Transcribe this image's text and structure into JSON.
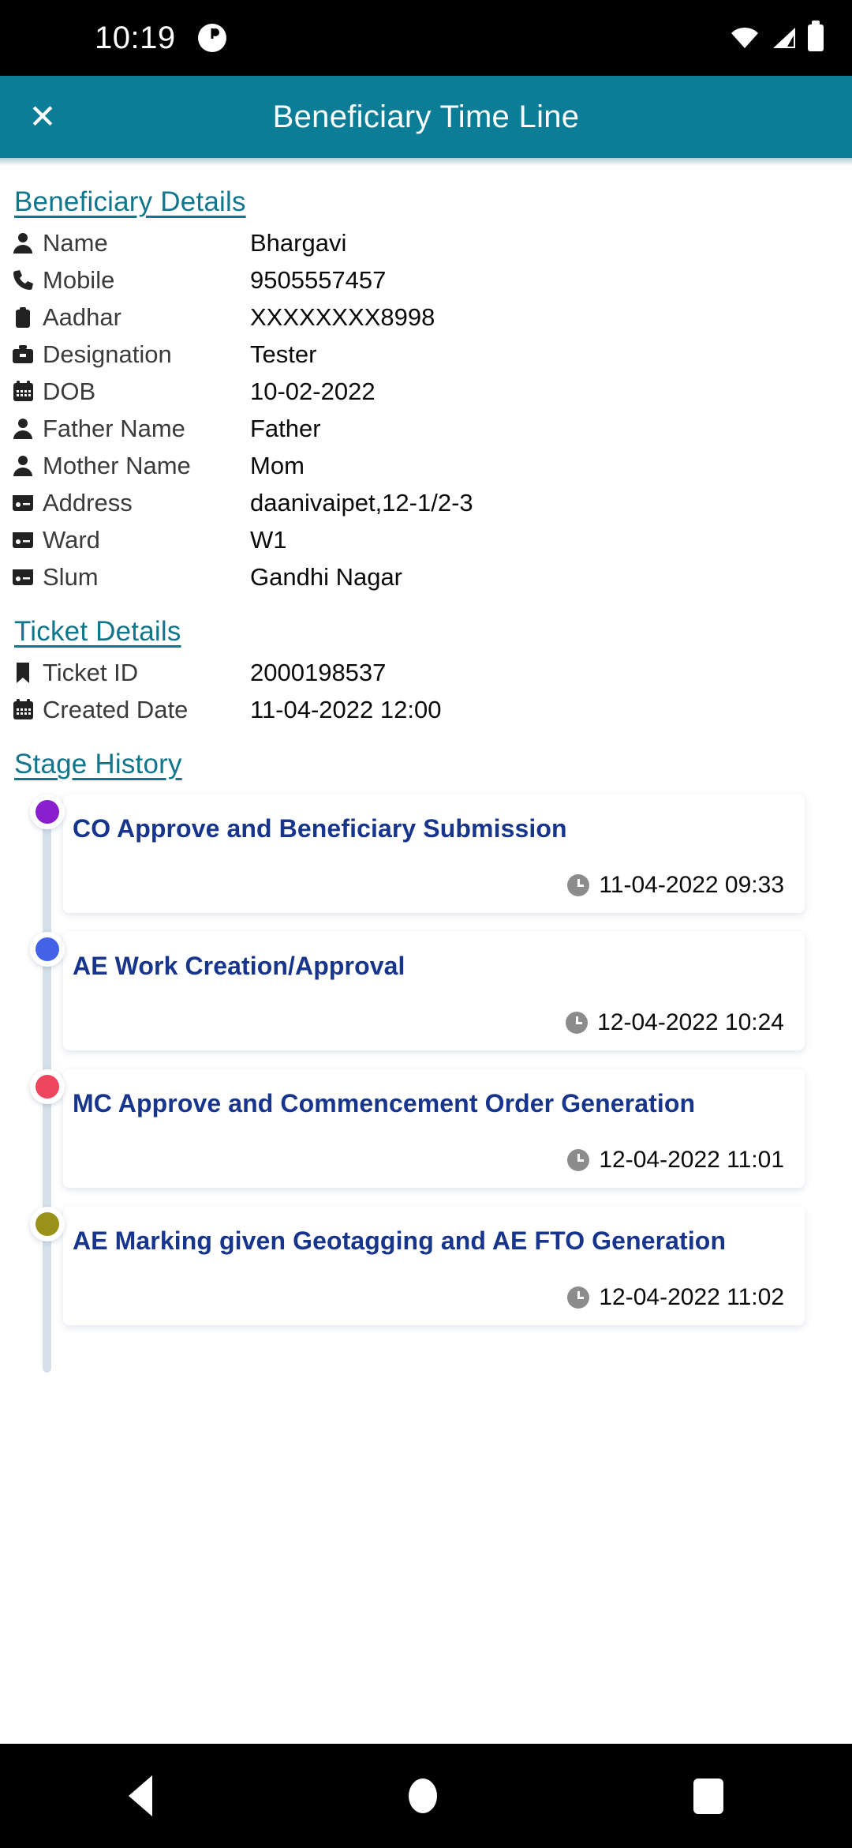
{
  "status_bar": {
    "time": "10:19",
    "icons": [
      "notification-dot-icon",
      "wifi-icon",
      "signal-icon",
      "battery-icon"
    ]
  },
  "app_bar": {
    "close_label": "✕",
    "title": "Beneficiary Time Line",
    "background": "#0b7d96"
  },
  "beneficiary": {
    "heading": "Beneficiary Details",
    "rows": [
      {
        "icon": "person-icon",
        "label": "Name",
        "value": "Bhargavi"
      },
      {
        "icon": "phone-icon",
        "label": "Mobile",
        "value": "9505557457"
      },
      {
        "icon": "id-card-icon",
        "label": "Aadhar",
        "value": "XXXXXXXX8998"
      },
      {
        "icon": "briefcase-icon",
        "label": "Designation",
        "value": "Tester"
      },
      {
        "icon": "calendar-icon",
        "label": "DOB",
        "value": "10-02-2022"
      },
      {
        "icon": "person-icon",
        "label": "Father Name",
        "value": "Father"
      },
      {
        "icon": "person-icon",
        "label": "Mother Name",
        "value": "Mom"
      },
      {
        "icon": "address-card-icon",
        "label": "Address",
        "value": "daanivaipet,12-1/2-3"
      },
      {
        "icon": "address-card-icon",
        "label": "Ward",
        "value": "W1"
      },
      {
        "icon": "address-card-icon",
        "label": "Slum",
        "value": "Gandhi Nagar"
      }
    ]
  },
  "ticket": {
    "heading": "Ticket Details",
    "rows": [
      {
        "icon": "bookmark-icon",
        "label": "Ticket ID",
        "value": "2000198537"
      },
      {
        "icon": "calendar-icon",
        "label": "Created Date",
        "value": "11-04-2022 12:00"
      }
    ]
  },
  "stage_history": {
    "heading": "Stage History",
    "items": [
      {
        "title": "CO Approve and Beneficiary Submission",
        "time": "11-04-2022 09:33",
        "dot_color": "#8a1fd0"
      },
      {
        "title": "AE Work Creation/Approval",
        "time": "12-04-2022 10:24",
        "dot_color": "#4263e8"
      },
      {
        "title": "MC Approve and Commencement Order Generation",
        "time": "12-04-2022 11:01",
        "dot_color": "#f0455f"
      },
      {
        "title": "AE Marking given Geotagging and AE FTO Generation",
        "time": "12-04-2022 11:02",
        "dot_color": "#9a9218"
      }
    ]
  },
  "nav_bar": {
    "back_label": "back-icon",
    "home_label": "home-icon",
    "recents_label": "recents-icon"
  },
  "colors": {
    "accent_teal": "#0b7d96",
    "heading_teal": "#11768c",
    "card_title_navy": "#17358c",
    "timeline_line": "#d5e0ea"
  }
}
